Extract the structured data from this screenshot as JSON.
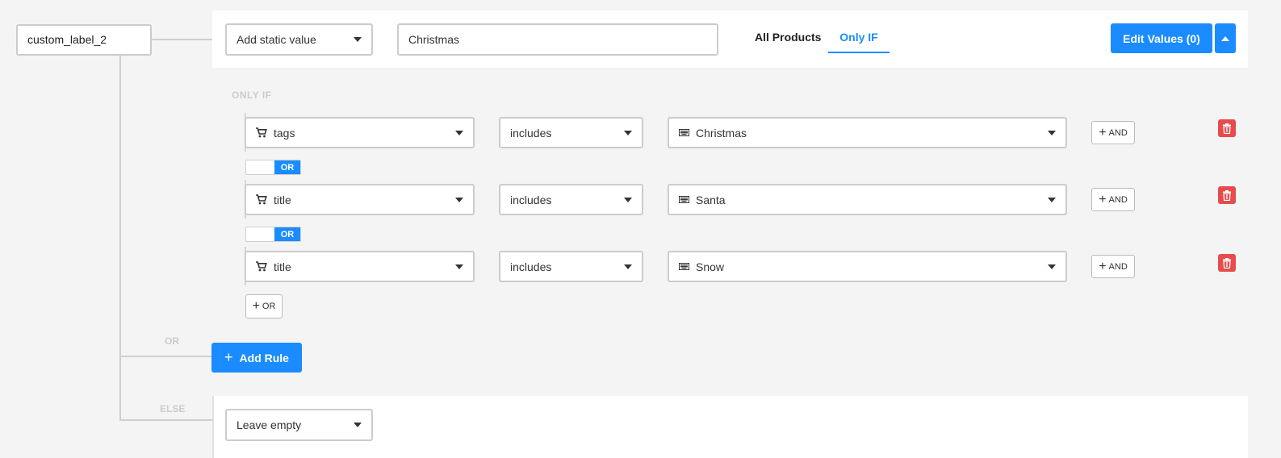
{
  "field": {
    "label": "custom_label_2"
  },
  "rule": {
    "value_type": "Add static value",
    "value": "Christmas",
    "tabs": [
      {
        "label": "All Products"
      },
      {
        "label": "Only IF"
      }
    ],
    "edit_values_label": "Edit Values (0)"
  },
  "only_if": {
    "title": "ONLY IF",
    "conditions": [
      {
        "field": "tags",
        "operator": "includes",
        "value": "Christmas"
      },
      {
        "field": "title",
        "operator": "includes",
        "value": "Santa"
      },
      {
        "field": "title",
        "operator": "includes",
        "value": "Snow"
      }
    ],
    "and_label": "AND",
    "toggle_label": "OR",
    "add_or_label": "OR"
  },
  "branches": {
    "or_label": "OR",
    "else_label": "ELSE"
  },
  "add_rule_label": "Add Rule",
  "else_rule": {
    "value_type": "Leave empty"
  },
  "colors": {
    "accent": "#1a8cff",
    "danger": "#e74c4c",
    "border": "#cccccc"
  },
  "icons": {
    "field": "cart-icon",
    "value": "keyboard-icon",
    "delete": "trash-icon"
  }
}
